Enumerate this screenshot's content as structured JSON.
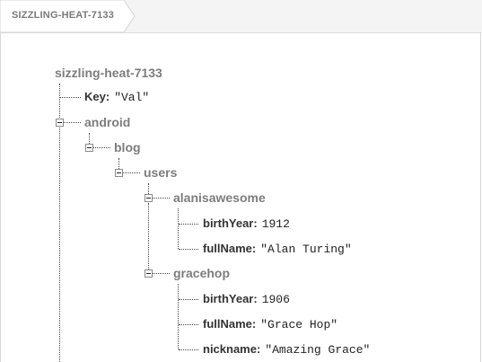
{
  "breadcrumb": {
    "label": "SIZZLING-HEAT-7133"
  },
  "tree": {
    "root": "sizzling-heat-7133",
    "key_leaf": {
      "key": "Key:",
      "value": "\"Val\""
    },
    "android": "android",
    "blog": "blog",
    "users": "users",
    "alanisawesome": {
      "name": "alanisawesome",
      "birthYear": {
        "key": "birthYear:",
        "value": "1912"
      },
      "fullName": {
        "key": "fullName:",
        "value": "\"Alan Turing\""
      }
    },
    "gracehop": {
      "name": "gracehop",
      "birthYear": {
        "key": "birthYear:",
        "value": "1906"
      },
      "fullName": {
        "key": "fullName:",
        "value": "\"Grace Hop\""
      },
      "nickname": {
        "key": "nickname:",
        "value": "\"Amazing Grace\""
      }
    }
  }
}
